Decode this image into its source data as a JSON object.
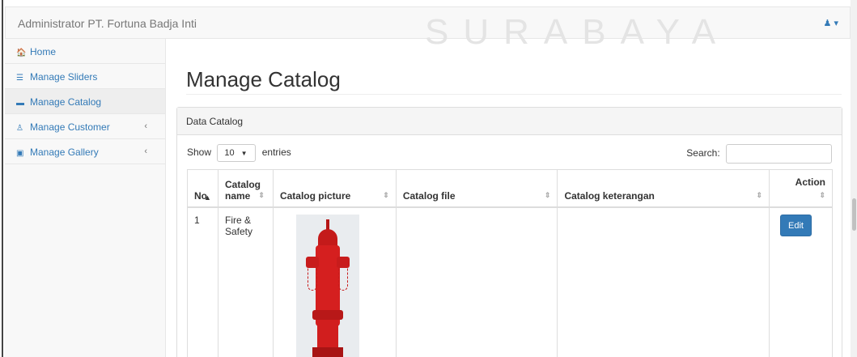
{
  "navbar": {
    "brand": "Administrator PT. Fortuna Badja Inti",
    "watermark": "SURABAYA",
    "user_icon": "user-icon",
    "caret": "▾"
  },
  "sidebar": {
    "items": [
      {
        "label": "Home",
        "icon": "home-icon",
        "glyph": "🏠",
        "active": false,
        "has_submenu": false
      },
      {
        "label": "Manage Sliders",
        "icon": "sliders-icon",
        "glyph": "☰",
        "active": false,
        "has_submenu": false
      },
      {
        "label": "Manage Catalog",
        "icon": "book-icon",
        "glyph": "▬",
        "active": true,
        "has_submenu": false
      },
      {
        "label": "Manage Customer",
        "icon": "person-icon",
        "glyph": "♙",
        "active": false,
        "has_submenu": true
      },
      {
        "label": "Manage Gallery",
        "icon": "picture-icon",
        "glyph": "▣",
        "active": false,
        "has_submenu": true
      }
    ],
    "submenu_chevron": "‹"
  },
  "main": {
    "title": "Manage Catalog",
    "panel": {
      "heading": "Data Catalog",
      "length": {
        "prefix": "Show",
        "value": "10",
        "suffix": "entries"
      },
      "search": {
        "label": "Search:",
        "value": ""
      },
      "table": {
        "columns": [
          {
            "line1": "No",
            "line2": "",
            "sort": "▲"
          },
          {
            "line1": "Catalog",
            "line2": "name",
            "sort": "⇕"
          },
          {
            "line1": "Catalog picture",
            "line2": "",
            "sort": "⇕"
          },
          {
            "line1": "Catalog file",
            "line2": "",
            "sort": "⇕"
          },
          {
            "line1": "Catalog keterangan",
            "line2": "",
            "sort": "⇕"
          },
          {
            "line1": "Action",
            "line2": "",
            "sort": "⇕"
          }
        ],
        "rows": [
          {
            "no": "1",
            "name_line1": "Fire &",
            "name_line2": "Safety",
            "picture": "hydrant",
            "file": "",
            "keterangan": "",
            "action_label": "Edit"
          }
        ]
      }
    }
  },
  "colors": {
    "link": "#337ab7",
    "button": "#337ab7",
    "hydrant_red": "#d51f1f"
  }
}
